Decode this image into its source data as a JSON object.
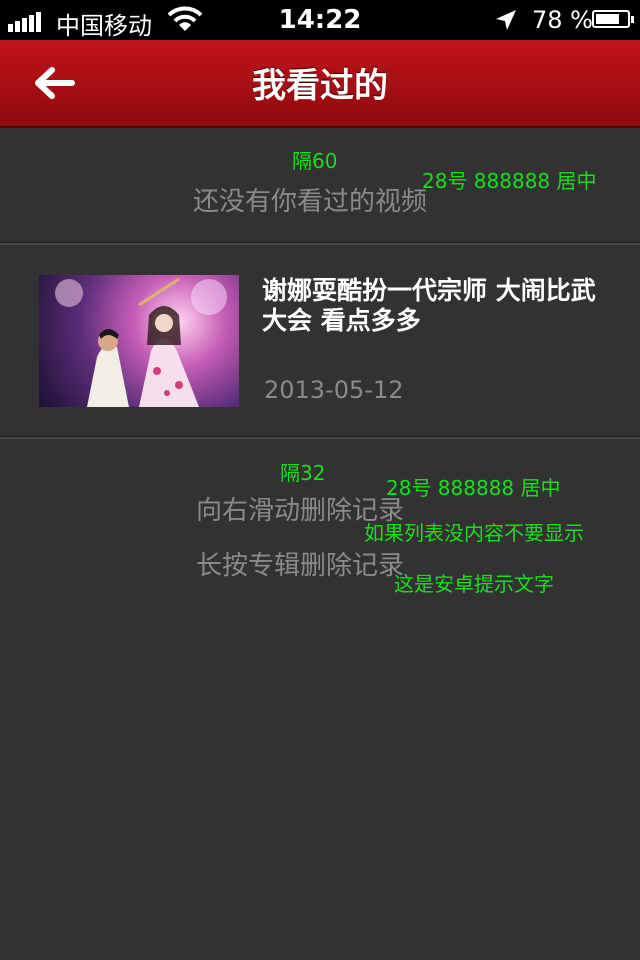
{
  "status_bar": {
    "carrier": "中国移动",
    "time": "14:22",
    "battery_percent": "78 %",
    "battery_level": 0.78,
    "icons": [
      "signal-icon",
      "wifi-icon",
      "location-icon",
      "battery-icon"
    ]
  },
  "nav_bar": {
    "title": "我看过的",
    "back_icon": "back-arrow-icon",
    "color": "#b01015"
  },
  "empty_state": {
    "message": "还没有你看过的视频"
  },
  "history": {
    "items": [
      {
        "title": "谢娜耍酷扮一代宗师 大闹比武大会 看点多多",
        "date": "2013-05-12"
      }
    ]
  },
  "hints": {
    "swipe_delete": "向右滑动删除记录",
    "long_press_delete": "长按专辑删除记录"
  },
  "annotations": {
    "spacing_top": "隔60",
    "font_spec_1": "28号 888888  居中",
    "spacing_hints": "隔32",
    "font_spec_2": "28号 888888  居中",
    "note_empty_list": "如果列表没内容不要显示",
    "note_android": "这是安卓提示文字",
    "color": "#18e018"
  }
}
